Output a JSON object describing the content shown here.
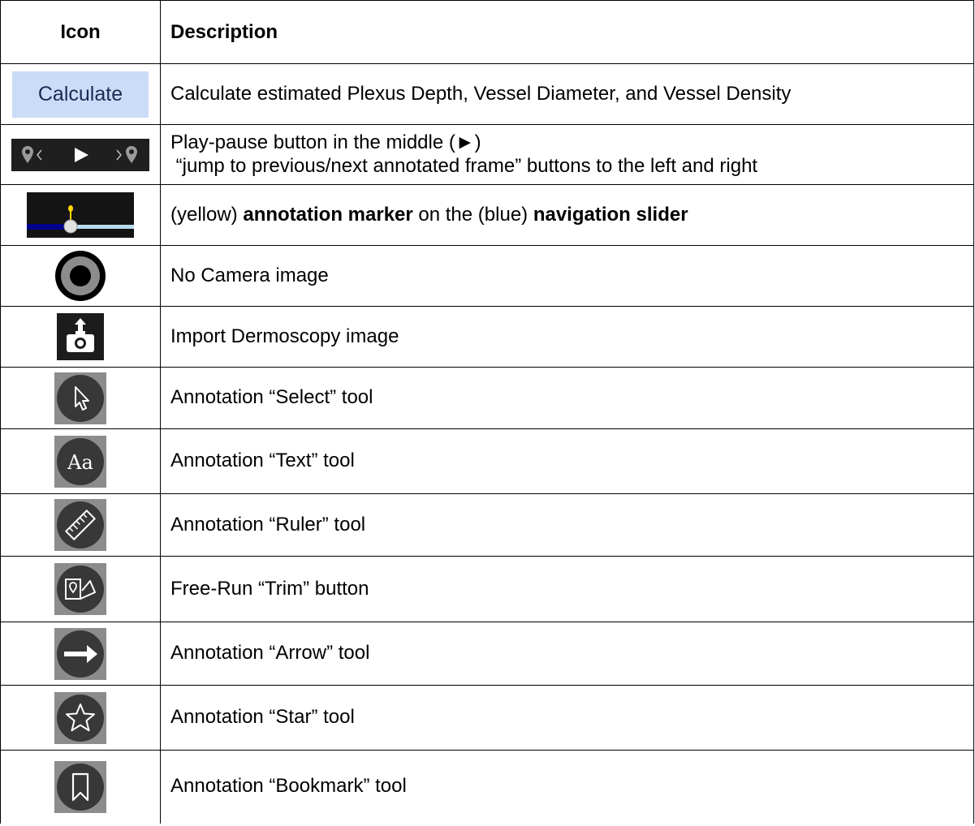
{
  "header": {
    "icon_col": "Icon",
    "desc_col": "Description"
  },
  "rows": [
    {
      "icon": "calculate-button",
      "icon_text": "Calculate",
      "desc": "Calculate estimated Plexus Depth, Vessel Diameter, and Vessel Density"
    },
    {
      "icon": "playback-controls",
      "desc_line1": "Play-pause button in the middle (►)",
      "desc_line2": " “jump to previous/next annotated frame” buttons to the left and right"
    },
    {
      "icon": "annotation-marker-slider",
      "desc_pre": "(yellow) ",
      "desc_b1": "annotation marker",
      "desc_mid": " on the (blue) ",
      "desc_b2": "navigation slider"
    },
    {
      "icon": "no-camera",
      "desc": "No Camera image"
    },
    {
      "icon": "import-camera",
      "desc": "Import Dermoscopy image"
    },
    {
      "icon": "cursor-arrow",
      "desc": "Annotation “Select” tool"
    },
    {
      "icon": "text-aa",
      "icon_text": "Aa",
      "desc": "Annotation “Text” tool"
    },
    {
      "icon": "ruler",
      "desc": "Annotation “Ruler” tool"
    },
    {
      "icon": "trim",
      "desc": "Free-Run “Trim” button"
    },
    {
      "icon": "arrow-right",
      "desc": "Annotation “Arrow” tool"
    },
    {
      "icon": "star",
      "desc": "Annotation “Star” tool"
    },
    {
      "icon": "bookmark",
      "desc": "Annotation “Bookmark” tool"
    }
  ],
  "colors": {
    "calc_bg": "#cadcf7",
    "slider_blue": "#00008b",
    "marker_yellow": "#ffd700",
    "tool_bg": "#8c8c8c",
    "tool_circle": "#383838"
  }
}
